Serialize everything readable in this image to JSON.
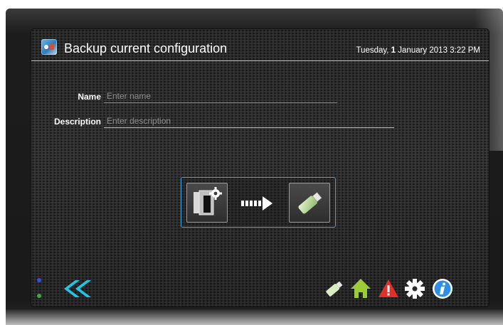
{
  "header": {
    "title": "Backup current configuration",
    "date_prefix": "Tuesday, ",
    "date_bold": "1",
    "date_suffix": " January 2013 3:22 PM"
  },
  "form": {
    "name_label": "Name",
    "name_placeholder": "Enter name",
    "description_label": "Description",
    "description_placeholder": "Enter description"
  },
  "backup_action": {
    "source_icon": "configuration-folder-gear-icon",
    "direction_icon": "dashed-arrow-right-icon",
    "target_icon": "usb-drive-icon"
  },
  "toolbar": {
    "back_icon": "double-chevron-left-icon",
    "usb_icon": "usb-drive-icon",
    "home_icon": "home-icon",
    "alert_icon": "warning-triangle-icon",
    "settings_icon": "gear-icon",
    "info_icon": "info-icon"
  },
  "colors": {
    "accent": "#3aa3e0",
    "back_arrow": "#22c7e8",
    "home": "#9ccc3a",
    "warning": "#e0302b",
    "info": "#2f8ee6"
  }
}
